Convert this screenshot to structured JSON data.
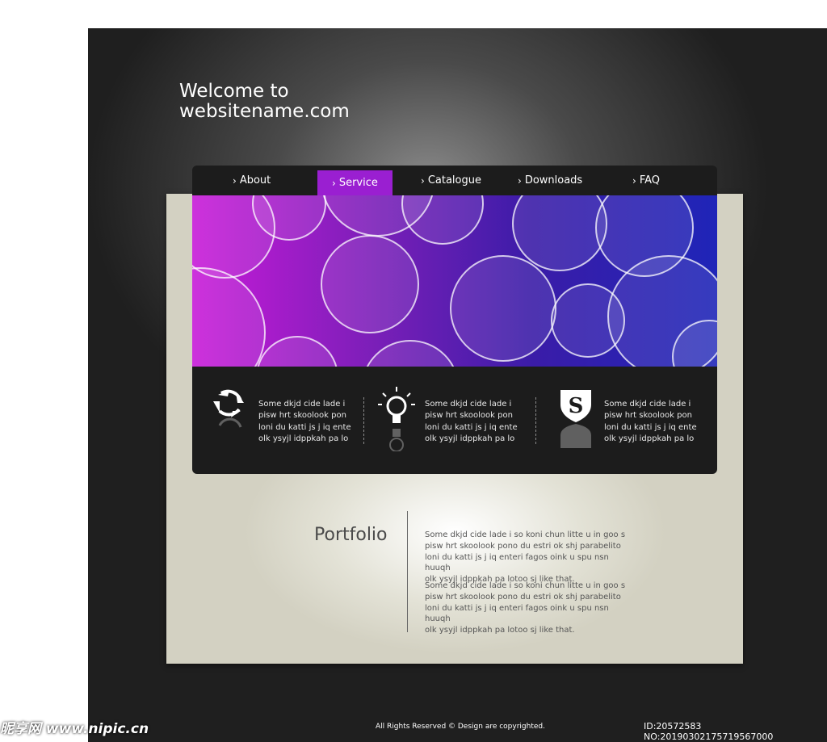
{
  "header": {
    "title_line1": "Welcome to",
    "title_line2": "websitename.com"
  },
  "nav": {
    "items": [
      {
        "label": "About",
        "active": false
      },
      {
        "label": "Service",
        "active": true
      },
      {
        "label": "Catalogue",
        "active": false
      },
      {
        "label": "Downloads",
        "active": false
      },
      {
        "label": "FAQ",
        "active": false
      }
    ],
    "chevron": "›",
    "active_color": "#9a1fd1"
  },
  "features": [
    {
      "icon": "recycle-arrows-icon",
      "text": "Some dkjd  cide lade i\npisw hrt skoolook pon\nloni du katti js j iq ente\nolk ysyjl idppkah pa lo"
    },
    {
      "icon": "lightbulb-icon",
      "text": "Some dkjd  cide lade i\npisw hrt skoolook pon\nloni du katti js j iq ente\nolk ysyjl idppkah pa lo"
    },
    {
      "icon": "shield-s-icon",
      "text": "Some dkjd  cide lade i\npisw hrt skoolook pon\nloni du katti js j iq ente\nolk ysyjl idppkah pa lo"
    }
  ],
  "portfolio": {
    "title": "Portfolio",
    "paragraph1": "Some dkjd  cide lade i so koni chun litte u in goo s\npisw hrt skoolook pono du estri ok shj parabelito\nloni du katti js j iq enteri fagos oink u spu nsn huuqh\nolk ysyjl idppkah pa lotoo sj like that.",
    "paragraph2": "Some dkjd  cide lade i so koni chun litte u in goo s\npisw hrt skoolook pono du estri ok shj parabelito\nloni du katti js j iq enteri fagos oink u spu nsn huuqh\nolk ysyjl idppkah pa lotoo sj like that."
  },
  "footer": {
    "copyright": "All Rights Reserved ©  Design are copyrighted."
  },
  "watermark": {
    "left": "昵享网 www.nipic.cn",
    "right": "ID:20572583 NO:20190302175719567000"
  }
}
